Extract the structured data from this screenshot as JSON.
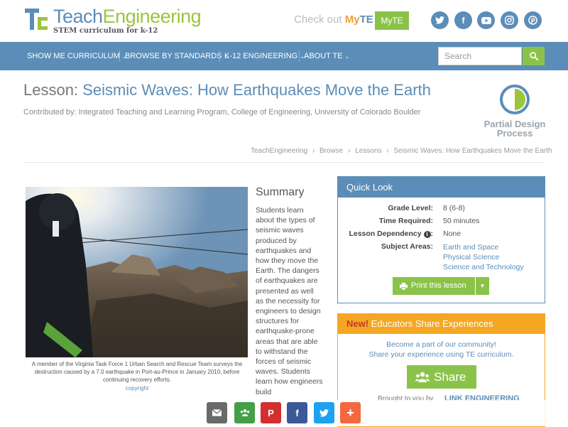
{
  "brand": {
    "title_part1": "Teach",
    "title_part2": "Engineering",
    "tagline": "STEM curriculum for k-12",
    "checkout_prefix": "Check out ",
    "checkout_my": "My",
    "checkout_te": "TE",
    "myte_button": "MyTE"
  },
  "social": [
    "twitter-icon",
    "facebook-icon",
    "youtube-icon",
    "instagram-icon",
    "pinterest-icon"
  ],
  "nav": {
    "items": [
      "SHOW ME CURRICULUM",
      "BROWSE BY STANDARDS",
      "K-12 ENGINEERING",
      "ABOUT TE"
    ],
    "caret": "⌄"
  },
  "search": {
    "placeholder": "Search"
  },
  "lesson": {
    "prefix": "Lesson: ",
    "title": "Seismic Waves: How Earthquakes Move the Earth",
    "contributed": "Contributed by: Integrated Teaching and Learning Program, College of Engineering, University of Colorado Boulder",
    "design_process_line1": "Partial Design",
    "design_process_line2": "Process"
  },
  "breadcrumb": [
    "TeachEngineering",
    "›",
    "Browse",
    "›",
    "Lessons",
    "›",
    "Seismic Waves: How Earthquakes Move the Earth"
  ],
  "photo": {
    "caption": "A member of the Virginia Task Force 1 Urban Search and Rescue Team surveys the destruction caused by a 7.0 earthquake in Port-au-Prince in January 2010, before continuing recovery efforts.",
    "copyright": "copyright"
  },
  "summary": {
    "title": "Summary",
    "text": "Students learn about the types of seismic waves produced by earthquakes and how they move the Earth. The dangers of earthquakes are presented as well as the necessity for engineers to design structures for earthquake-prone areas that are able to withstand the forces of seismic waves. Students learn how engineers build"
  },
  "quick_look": {
    "title": "Quick Look",
    "grade_label": "Grade Level:",
    "grade_value": "8 (6-8)",
    "time_label": "Time Required:",
    "time_value": "50 minutes",
    "dependency_label": "Lesson Dependency",
    "dependency_value": "None",
    "subjects_label": "Subject Areas:",
    "subjects": [
      "Earth and Space",
      "Physical Science",
      "Science and Technology"
    ],
    "print_button": "Print this lesson"
  },
  "educators": {
    "new_label": "New!",
    "title": " Educators Share Experiences",
    "line1": "Become a part of our community!",
    "line2": "Share your experience using TE curriculum.",
    "share_button": "Share",
    "brought": "Brought to you by",
    "brought_logo": "LINK ENGINEERING"
  },
  "sharebar": [
    "email-icon",
    "share-icon",
    "pinterest-icon",
    "facebook-icon",
    "twitter-icon",
    "plus-icon"
  ],
  "colors": {
    "brand_blue": "#5b8db8",
    "brand_green": "#8bc34a",
    "orange": "#f5a623"
  }
}
